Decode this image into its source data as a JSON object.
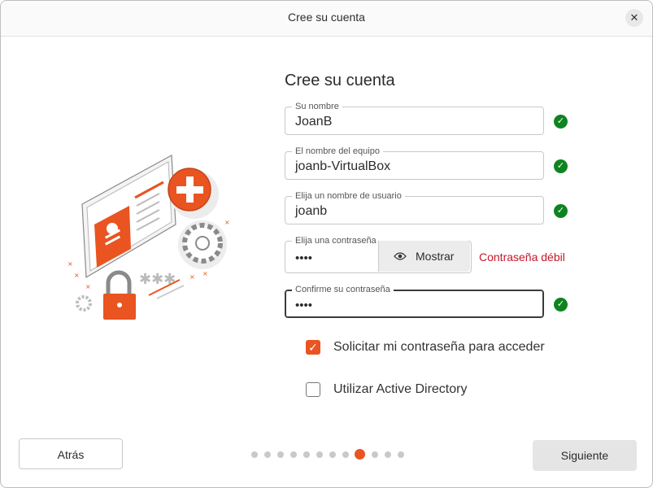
{
  "window": {
    "title": "Cree su cuenta"
  },
  "heading": "Cree su cuenta",
  "fields": {
    "name": {
      "label": "Su nombre",
      "value": "JoanB"
    },
    "computer": {
      "label": "El nombre del equipo",
      "value": "joanb-VirtualBox"
    },
    "username": {
      "label": "Elija un nombre de usuario",
      "value": "joanb"
    },
    "password": {
      "label": "Elija una contraseña",
      "value": "••••"
    },
    "confirm": {
      "label": "Confirme su contraseña",
      "value": "••••"
    }
  },
  "show_button": "Mostrar",
  "password_strength": "Contraseña débil",
  "options": {
    "require_password": {
      "label": "Solicitar mi contraseña para acceder",
      "checked": true
    },
    "active_directory": {
      "label": "Utilizar Active Directory",
      "checked": false
    }
  },
  "buttons": {
    "back": "Atrás",
    "next": "Siguiente"
  },
  "progress": {
    "total_steps": 12,
    "current_step": 9
  },
  "colors": {
    "accent": "#E95420",
    "success": "#0E8420",
    "error": "#C7162B"
  }
}
